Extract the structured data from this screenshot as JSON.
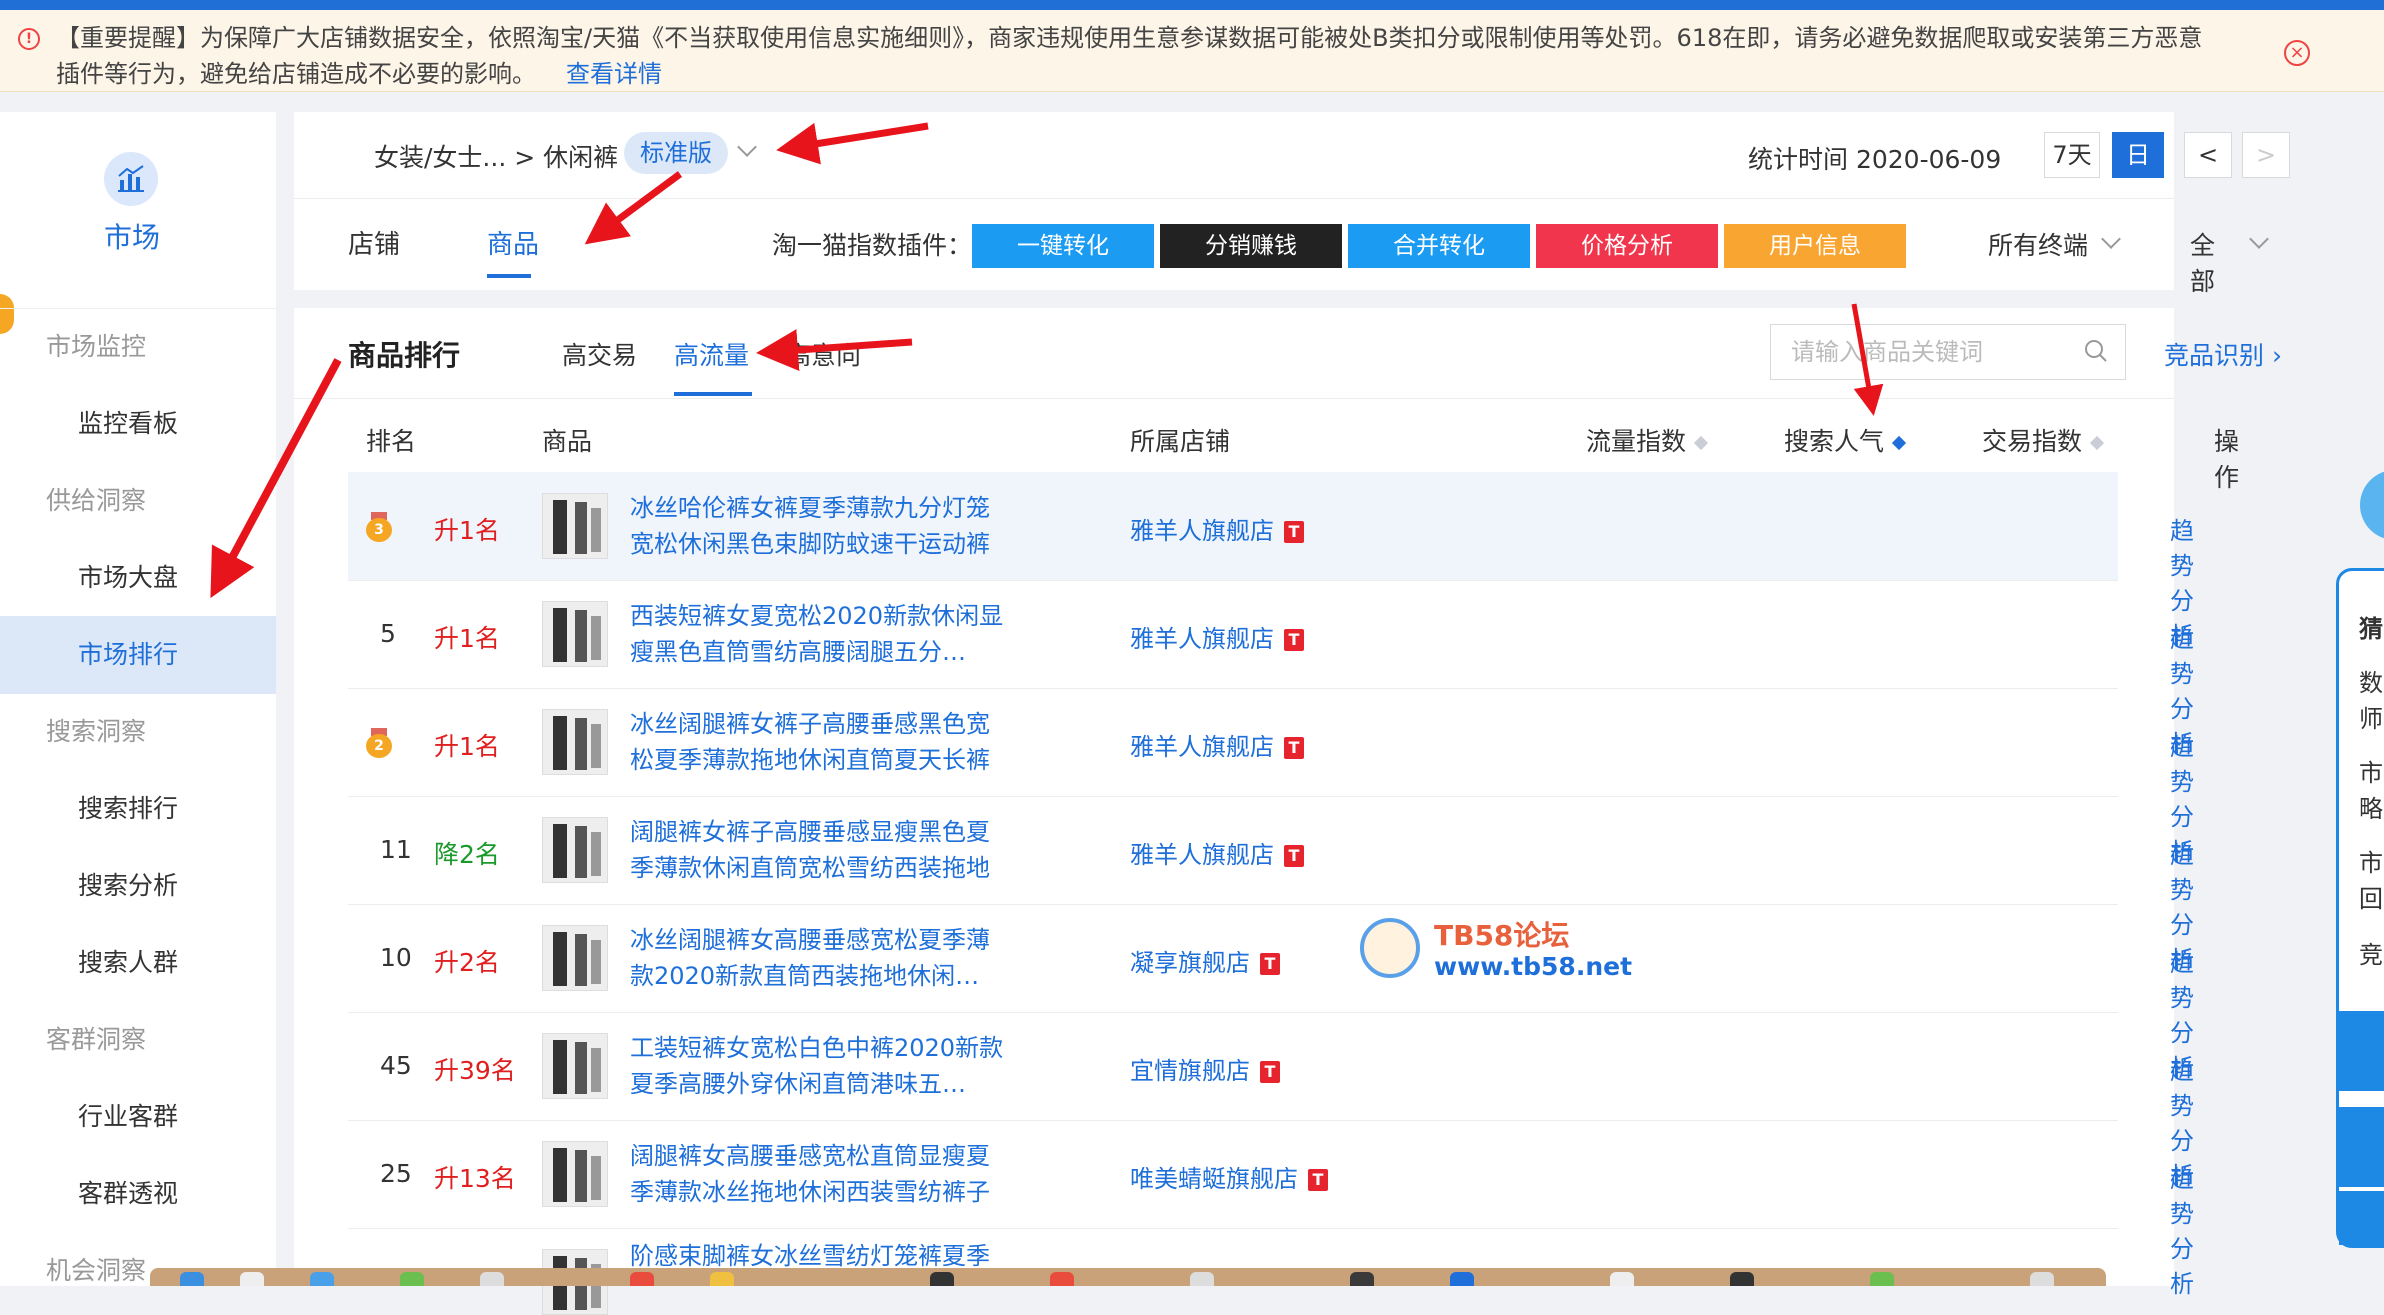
{
  "banner": {
    "message": "【重要提醒】为保障广大店铺数据安全，依照淘宝/天猫《不当获取使用信息实施细则》，商家违规使用生意参谋数据可能被处B类扣分或限制使用等处罚。618在即，请务必避免数据爬取或安装第三方恶意插件等行为，避免给店铺造成不必要的影响。",
    "link": "查看详情"
  },
  "sidebar": {
    "title": "市场",
    "items": [
      {
        "label": "市场监控",
        "type": "group"
      },
      {
        "label": "监控看板",
        "type": "link"
      },
      {
        "label": "供给洞察",
        "type": "group"
      },
      {
        "label": "市场大盘",
        "type": "link"
      },
      {
        "label": "市场排行",
        "type": "link",
        "active": true
      },
      {
        "label": "搜索洞察",
        "type": "group"
      },
      {
        "label": "搜索排行",
        "type": "link"
      },
      {
        "label": "搜索分析",
        "type": "link"
      },
      {
        "label": "搜索人群",
        "type": "link"
      },
      {
        "label": "客群洞察",
        "type": "group"
      },
      {
        "label": "行业客群",
        "type": "link"
      },
      {
        "label": "客群透视",
        "type": "link"
      },
      {
        "label": "机会洞察",
        "type": "group"
      }
    ]
  },
  "header": {
    "breadcrumb": "女装/女士... > 休闲裤",
    "edition": "标准版",
    "stat_label": "统计时间 2020-06-09",
    "range_7d": "7天",
    "range_day": "日",
    "prev": "<",
    "next": ">",
    "tabs": [
      "店铺",
      "商品"
    ],
    "plugin_label": "淘一猫指数插件：",
    "plugins": [
      "一键转化",
      "分销赚钱",
      "合并转化",
      "价格分析",
      "用户信息"
    ],
    "plugin_colors": [
      "#1b9cf2",
      "#222222",
      "#1b9cf2",
      "#f0354c",
      "#f9a531"
    ],
    "terminal": "所有终端",
    "all": "全部"
  },
  "main": {
    "title": "商品排行",
    "subtabs": [
      "高交易",
      "高流量",
      "高意向"
    ],
    "search_placeholder": "请输入商品关键词",
    "compete": "竞品识别",
    "columns": [
      "排名",
      "商品",
      "所属店铺",
      "流量指数",
      "搜索人气",
      "交易指数",
      "操作"
    ],
    "rows": [
      {
        "rank": "3",
        "medal": true,
        "change": "升1名",
        "dir": "up",
        "name": "冰丝哈伦裤女裤夏季薄款九分灯笼宽松休闲黑色束脚防蚊速干运动裤",
        "shop": "雅羊人旗舰店",
        "action": "趋势分析"
      },
      {
        "rank": "5",
        "medal": false,
        "change": "升1名",
        "dir": "up",
        "name": "西装短裤女夏宽松2020新款休闲显瘦黑色直筒雪纺高腰阔腿五分…",
        "shop": "雅羊人旗舰店",
        "action": "趋势分析"
      },
      {
        "rank": "2",
        "medal": true,
        "change": "升1名",
        "dir": "up",
        "name": "冰丝阔腿裤女裤子高腰垂感黑色宽松夏季薄款拖地休闲直筒夏天长裤",
        "shop": "雅羊人旗舰店",
        "action": "趋势分析"
      },
      {
        "rank": "11",
        "medal": false,
        "change": "降2名",
        "dir": "down",
        "name": "阔腿裤女裤子高腰垂感显瘦黑色夏季薄款休闲直筒宽松雪纺西装拖地",
        "shop": "雅羊人旗舰店",
        "action": "趋势分析"
      },
      {
        "rank": "10",
        "medal": false,
        "change": "升2名",
        "dir": "up",
        "name": "冰丝阔腿裤女高腰垂感宽松夏季薄款2020新款直筒西装拖地休闲…",
        "shop": "凝享旗舰店",
        "action": "趋势分析"
      },
      {
        "rank": "45",
        "medal": false,
        "change": "升39名",
        "dir": "up",
        "name": "工装短裤女宽松白色中裤2020新款夏季高腰外穿休闲直筒港味五…",
        "shop": "宜情旗舰店",
        "action": "趋势分析"
      },
      {
        "rank": "25",
        "medal": false,
        "change": "升13名",
        "dir": "up",
        "name": "阔腿裤女高腰垂感宽松直筒显瘦夏季薄款冰丝拖地休闲西装雪纺裤子",
        "shop": "唯美蜻蜓旗舰店",
        "action": "趋势分析"
      },
      {
        "rank": "",
        "medal": false,
        "change": "",
        "dir": "up",
        "name": "阶感束脚裤女冰丝雪纺灯笼裤夏季",
        "shop": "",
        "action": ""
      }
    ],
    "tmall_badge": "T"
  },
  "watermark": {
    "line1": "TB58论坛",
    "line2": "www.tb58.net"
  },
  "right_widget": [
    "猜",
    "数",
    "师",
    "市",
    "略",
    "市",
    "回",
    "竞"
  ]
}
